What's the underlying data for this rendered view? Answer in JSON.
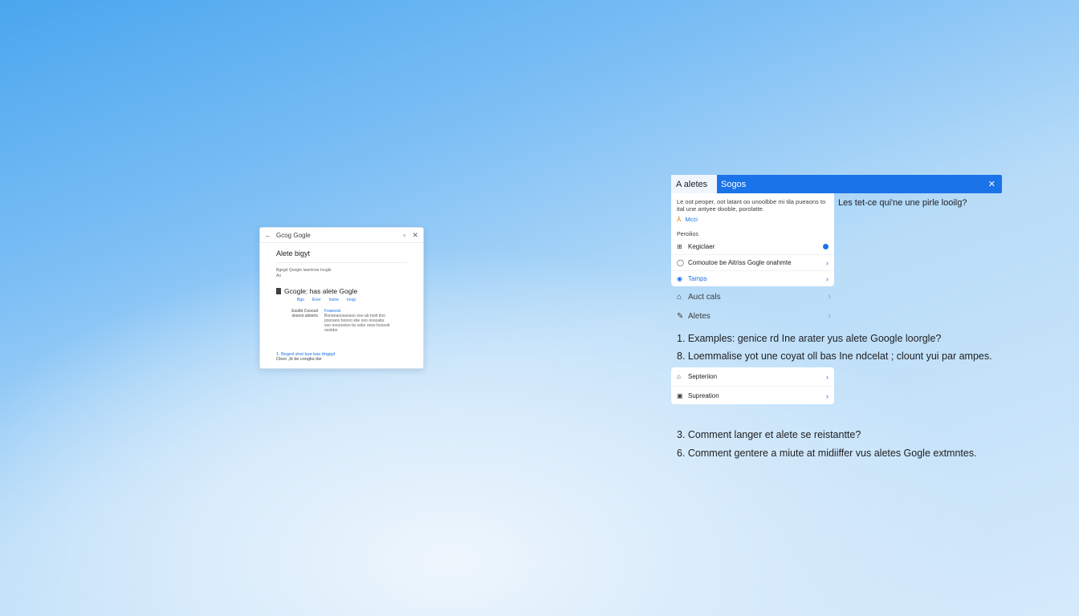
{
  "mini_window": {
    "title": "Gcog Gogle",
    "back_icon": "arrow-left-icon",
    "heading": "Alete bigyt",
    "small_lines": [
      "Bgegd Qoogle Iawmnoe Iougle",
      "Ao"
    ],
    "section_title": "Gcogle: has alete Gogle",
    "links": [
      "Bgo",
      "Eoor",
      "Ioone",
      "Ioogi"
    ],
    "table_left": [
      "Eoulbt Cooouit",
      "oioeoo aloiorts"
    ],
    "table_right_link": "Foaeosio",
    "table_right_lines": [
      "Bonanaoosaosoo ooo ab boid tioo",
      "poooaoo boooo sbe ooo ooooabs",
      "soo ooooooioo bs ssbo ooos boosob",
      "oosbbo"
    ],
    "footer_link": "1. Beged shet bue bao bhgigd",
    "footer_text": "Cboo ,Ib be coogbs ibe"
  },
  "panel": {
    "tab_label": "A aletes",
    "header_title": "Sogos",
    "close_icon": "close-icon",
    "description": "Le oot peoper, oot latant oo unoolbbe mi tila pueaons to ital une antyee dooble, porolatte.",
    "accent_label": "Mcci",
    "subheading": "Peroilios",
    "rows": [
      {
        "icon": "grid-icon",
        "label": "Kegiclaer"
      },
      {
        "icon": "circle-icon",
        "label": "Comoutoe be Aitriss Gogle onahmte"
      },
      {
        "icon": "tag-icon",
        "label": "Tamps"
      }
    ],
    "side_question": "Les tet-ce qui'ne une pirle looilg?"
  },
  "plain_rows": [
    {
      "icon": "building-icon",
      "label": "Auct cals"
    },
    {
      "icon": "edit-icon",
      "label": "Aletes"
    }
  ],
  "questions": {
    "q1": "1. Examples: genice rd Ine arater yus alete Google loorgle?",
    "q2": "8. Loemmalise yot une coyat oll bas Ine ndcelat ; clount yui par ampes.",
    "q3": "3. Comment langer et alete se reistantte?",
    "q4": "6. Comment gentere a miute at midiiffer vus aletes Gogle extmntes."
  },
  "card2_rows": [
    {
      "icon": "home-icon",
      "label": "Septeriion"
    },
    {
      "icon": "square-icon",
      "label": "Supreation"
    }
  ],
  "colors": {
    "accent": "#1a73e8",
    "background_top": "#4aa6ee",
    "background_bottom": "#d6eafb"
  }
}
